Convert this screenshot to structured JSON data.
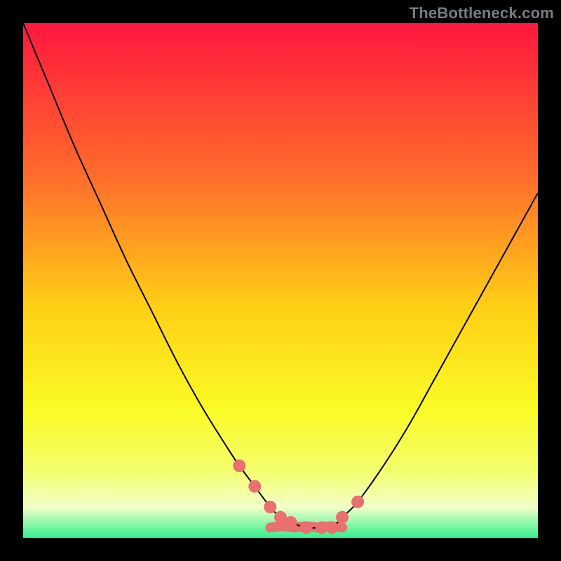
{
  "watermark": "TheBottleneck.com",
  "colors": {
    "gradient_top": "#ff173e",
    "gradient_mid1": "#ff6d2b",
    "gradient_mid2": "#ffcf16",
    "gradient_mid3": "#fafb24",
    "gradient_mid4": "#f4fe6e",
    "gradient_bottom_pale": "#f2ffc8",
    "gradient_bottom": "#35f08c",
    "marker": "#e9706f",
    "curve": "#000000",
    "frame": "#000000"
  },
  "chart_data": {
    "type": "line",
    "title": "",
    "xlabel": "",
    "ylabel": "",
    "xlim": [
      0,
      100
    ],
    "ylim": [
      0,
      100
    ],
    "grid": false,
    "legend": false,
    "series": [
      {
        "name": "bottleneck-curve",
        "x": [
          0,
          5,
          10,
          15,
          20,
          25,
          30,
          35,
          40,
          42,
          45,
          48,
          50,
          52,
          55,
          58,
          60,
          62,
          65,
          70,
          75,
          80,
          85,
          90,
          95,
          100
        ],
        "values": [
          100,
          88,
          76,
          65,
          54,
          44,
          34,
          25,
          17,
          14,
          10,
          6,
          4,
          3,
          2,
          2,
          2,
          4,
          7,
          14,
          22,
          31,
          40,
          49,
          58,
          67
        ]
      }
    ],
    "markers": {
      "name": "highlighted-points",
      "x": [
        42,
        45,
        48,
        50,
        52,
        55,
        58,
        60,
        62,
        65
      ],
      "values": [
        14,
        10,
        6,
        4,
        3,
        2,
        2,
        2,
        4,
        7
      ]
    },
    "flat_segment": {
      "x_start": 48,
      "x_end": 62,
      "y": 2
    }
  }
}
